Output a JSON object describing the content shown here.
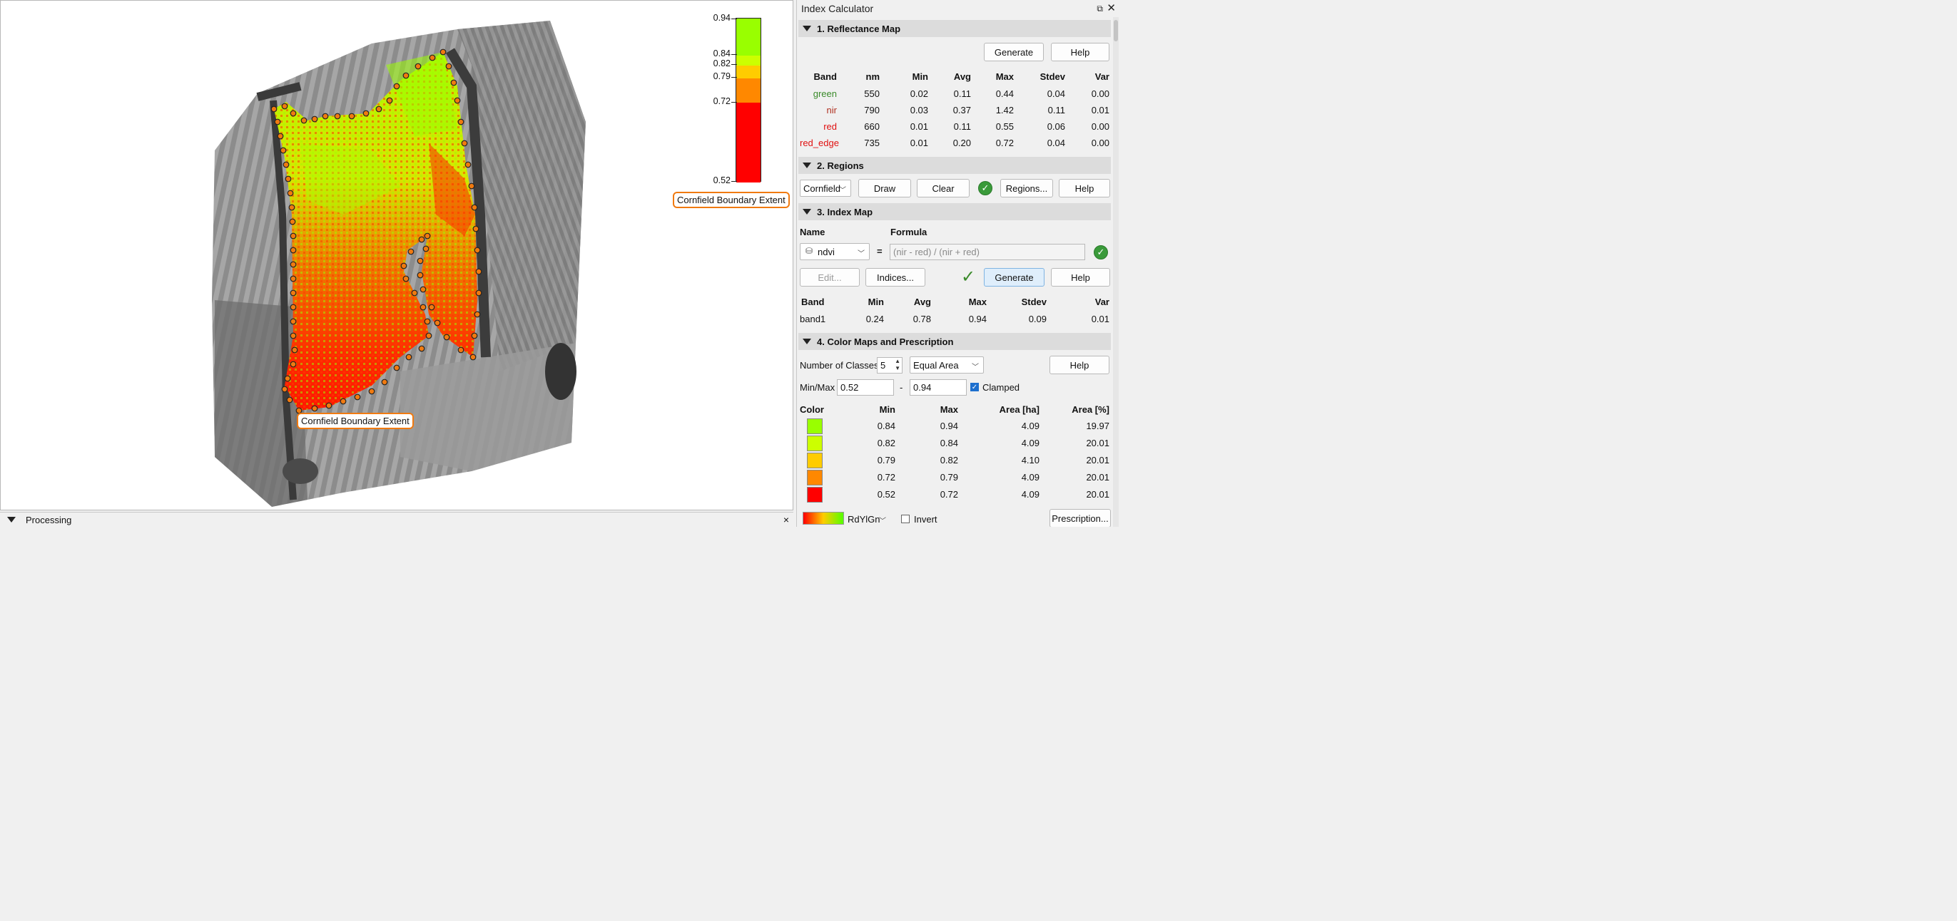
{
  "map": {
    "labels": {
      "field_label": "Cornfield Boundary Extent",
      "legend_label": "Cornfield Boundary Extent"
    },
    "legend": {
      "ticks": [
        "0.94",
        "0.84",
        "0.82",
        "0.79",
        "0.72",
        "0.52"
      ],
      "colors": [
        "#99ff00",
        "#ccff00",
        "#ffcc00",
        "#ff8800",
        "#ff0000"
      ]
    }
  },
  "processing": {
    "title": "Processing",
    "close": "×"
  },
  "panel": {
    "title": "Index Calculator",
    "sections": {
      "reflectance": {
        "title": "1. Reflectance Map",
        "generate": "Generate",
        "help": "Help",
        "headers": [
          "Band",
          "nm",
          "Min",
          "Avg",
          "Max",
          "Stdev",
          "Var"
        ],
        "rows": [
          {
            "band": "green",
            "color": "#3a8a2a",
            "nm": "550",
            "min": "0.02",
            "avg": "0.11",
            "max": "0.44",
            "stdev": "0.04",
            "var": "0.00"
          },
          {
            "band": "nir",
            "color": "#b03020",
            "nm": "790",
            "min": "0.03",
            "avg": "0.37",
            "max": "1.42",
            "stdev": "0.11",
            "var": "0.01"
          },
          {
            "band": "red",
            "color": "#e01010",
            "nm": "660",
            "min": "0.01",
            "avg": "0.11",
            "max": "0.55",
            "stdev": "0.06",
            "var": "0.00"
          },
          {
            "band": "red_edge",
            "color": "#e01010",
            "nm": "735",
            "min": "0.01",
            "avg": "0.20",
            "max": "0.72",
            "stdev": "0.04",
            "var": "0.00"
          }
        ]
      },
      "regions": {
        "title": "2. Regions",
        "selected": "Cornfield",
        "draw": "Draw",
        "clear": "Clear",
        "regions": "Regions...",
        "help": "Help"
      },
      "index_map": {
        "title": "3. Index Map",
        "name_label": "Name",
        "formula_label": "Formula",
        "name_value": "ndvi",
        "equals": "=",
        "formula": "(nir - red) / (nir + red)",
        "edit": "Edit...",
        "indices": "Indices...",
        "generate": "Generate",
        "help": "Help",
        "headers": [
          "Band",
          "Min",
          "Avg",
          "Max",
          "Stdev",
          "Var"
        ],
        "row": {
          "band": "band1",
          "min": "0.24",
          "avg": "0.78",
          "max": "0.94",
          "stdev": "0.09",
          "var": "0.01"
        }
      },
      "color_maps": {
        "title": "4. Color Maps and Prescription",
        "classes_label": "Number of Classes",
        "classes_value": "5",
        "method": "Equal Area",
        "help": "Help",
        "minmax_label": "Min/Max",
        "min_value": "0.52",
        "dash": "-",
        "max_value": "0.94",
        "clamped_label": "Clamped",
        "headers": [
          "Color",
          "Min",
          "Max",
          "Area [ha]",
          "Area [%]"
        ],
        "rows": [
          {
            "color": "#99ff00",
            "min": "0.84",
            "max": "0.94",
            "area_ha": "4.09",
            "area_pct": "19.97"
          },
          {
            "color": "#ccff00",
            "min": "0.82",
            "max": "0.84",
            "area_ha": "4.09",
            "area_pct": "20.01"
          },
          {
            "color": "#ffcc00",
            "min": "0.79",
            "max": "0.82",
            "area_ha": "4.10",
            "area_pct": "20.01"
          },
          {
            "color": "#ff8800",
            "min": "0.72",
            "max": "0.79",
            "area_ha": "4.09",
            "area_pct": "20.01"
          },
          {
            "color": "#ff0000",
            "min": "0.52",
            "max": "0.72",
            "area_ha": "4.09",
            "area_pct": "20.01"
          }
        ],
        "colormap_name": "RdYlGn",
        "invert_label": "Invert",
        "prescription": "Prescription..."
      }
    }
  }
}
